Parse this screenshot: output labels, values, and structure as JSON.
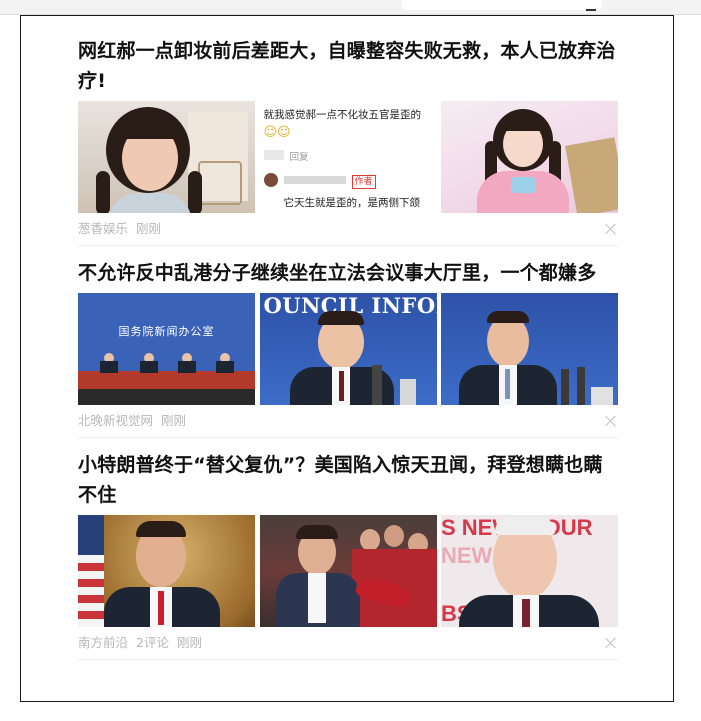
{
  "articles": [
    {
      "title": "网红郝一点卸妆前后差距大，自曝整容失败无救，本人已放弃治疗!",
      "source": "葱香娱乐",
      "time": "刚刚",
      "comments": "",
      "thumb2": {
        "line1": "就我感觉郝一点不化妆五官是歪的",
        "reply": "回复",
        "author_tag": "作者",
        "line2": "它天生就是歪的，是两侧下颌"
      }
    },
    {
      "title": "不允许反中乱港分子继续坐在立法会议事大厅里，一个都嫌多",
      "source": "北晚新视觉网",
      "time": "刚刚",
      "comments": "",
      "thumb1": {
        "banner": "国务院新闻办公室"
      },
      "thumb2": {
        "banner": "OUNCIL INFORMAT"
      }
    },
    {
      "title": "小特朗普终于“替父复仇”？美国陷入惊天丑闻，拜登想瞒也瞒不住",
      "source": "南方前沿",
      "time": "刚刚",
      "comments": "2评论",
      "thumb3": {
        "line1": "S NEWSHOUR",
        "line2": "NEW PBS",
        "line3": "BS HOUR"
      }
    }
  ]
}
